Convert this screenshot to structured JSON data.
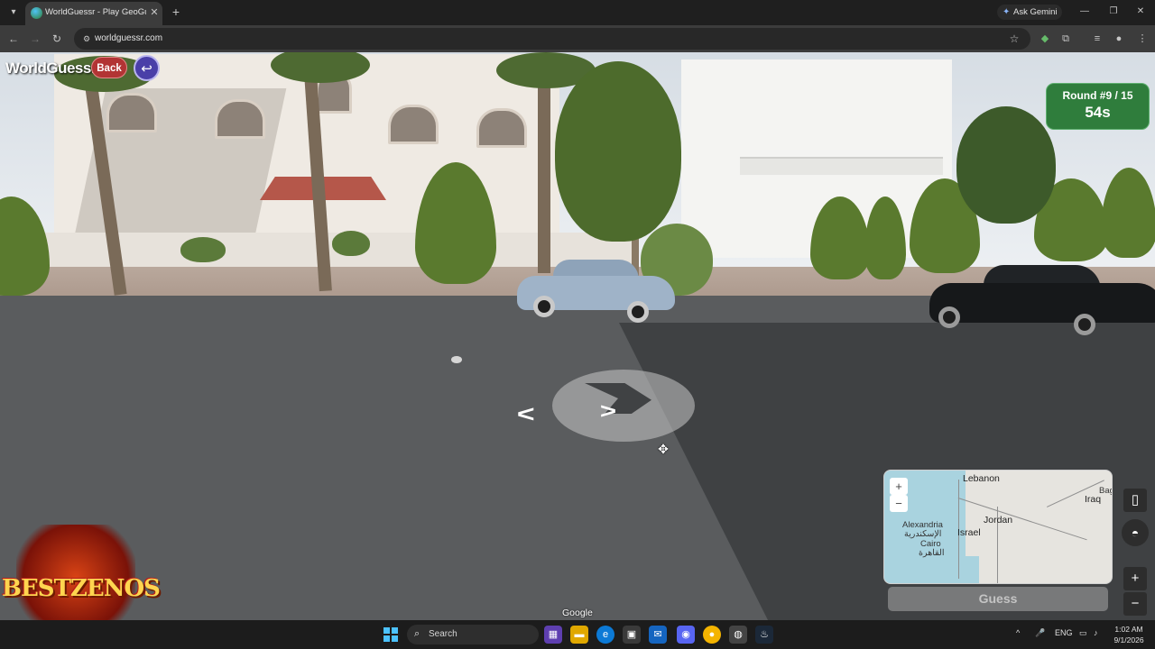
{
  "browser": {
    "tab_title": "WorldGuessr - Play GeoGuessr",
    "url": "worldguessr.com",
    "ask_gemini": "Ask Gemini"
  },
  "game": {
    "logo": "WorldGuessr",
    "back_label": "Back",
    "round": "Round #9 / 15",
    "timer": "54s",
    "guess_label": "Guess",
    "attribution": "Google"
  },
  "minimap": {
    "labels": {
      "lebanon": "Lebanon",
      "iraq": "Iraq",
      "baghdad": "Bag",
      "jordan": "Jordan",
      "israel": "Israel",
      "alexandria": "Alexandria",
      "alexandria_ar": "الإسكندرية",
      "cairo": "Cairo",
      "cairo_ar": "القاهرة"
    }
  },
  "overlay_logo": {
    "text": "BESTZENOS"
  },
  "taskbar": {
    "search_label": "Search",
    "language": "ENG",
    "time": "1:02 AM",
    "date": "9/1/2026"
  },
  "colors": {
    "round_box": "#2f7d3c",
    "back_button": "#b23434",
    "undo_button": "#4a3fa8"
  }
}
